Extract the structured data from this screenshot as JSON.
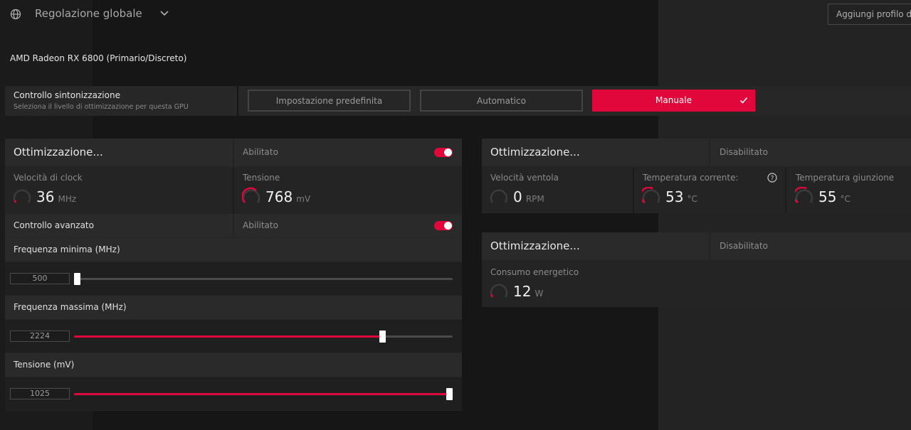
{
  "header": {
    "title": "Regolazione globale",
    "add_profile": "Aggiungi profilo di..."
  },
  "gpu_name": "AMD Radeon RX 6800 (Primario/Discreto)",
  "tuning": {
    "label": "Controllo sintonizzazione",
    "description": "Seleziona il livello di ottimizzazione per questa GPU",
    "modes": [
      "Impostazione predefinita",
      "Automatico",
      "Manuale"
    ],
    "selected": "Manuale"
  },
  "gpu_panel": {
    "title": "Ottimizzazione...",
    "state": "Abilitato",
    "clock": {
      "label": "Velocità di clock",
      "value": "36",
      "unit": "MHz"
    },
    "voltage": {
      "label": "Tensione",
      "value": "768",
      "unit": "mV"
    },
    "advanced": {
      "label": "Controllo avanzato",
      "state": "Abilitato"
    },
    "sliders": [
      {
        "label": "Frequenza minima (MHz)",
        "value": "500",
        "fraction": 0.0
      },
      {
        "label": "Frequenza massima (MHz)",
        "value": "2224",
        "fraction": 0.82
      },
      {
        "label": "Tensione (mV)",
        "value": "1025",
        "fraction": 1.0
      }
    ]
  },
  "fan_panel": {
    "title": "Ottimizzazione...",
    "state": "Disabilitato",
    "fan": {
      "label": "Velocità ventola",
      "value": "0",
      "unit": "RPM"
    },
    "temp": {
      "label": "Temperatura corrente:",
      "value": "53",
      "unit": "°C"
    },
    "junction": {
      "label": "Temperatura giunzione",
      "value": "55",
      "unit": "°C"
    }
  },
  "power_panel": {
    "title": "Ottimizzazione...",
    "state": "Disabilitato",
    "power": {
      "label": "Consumo energetico",
      "value": "12",
      "unit": "W"
    }
  },
  "colors": {
    "accent": "#e2073a",
    "panel": "#242425",
    "background": "#1b1b1c"
  }
}
